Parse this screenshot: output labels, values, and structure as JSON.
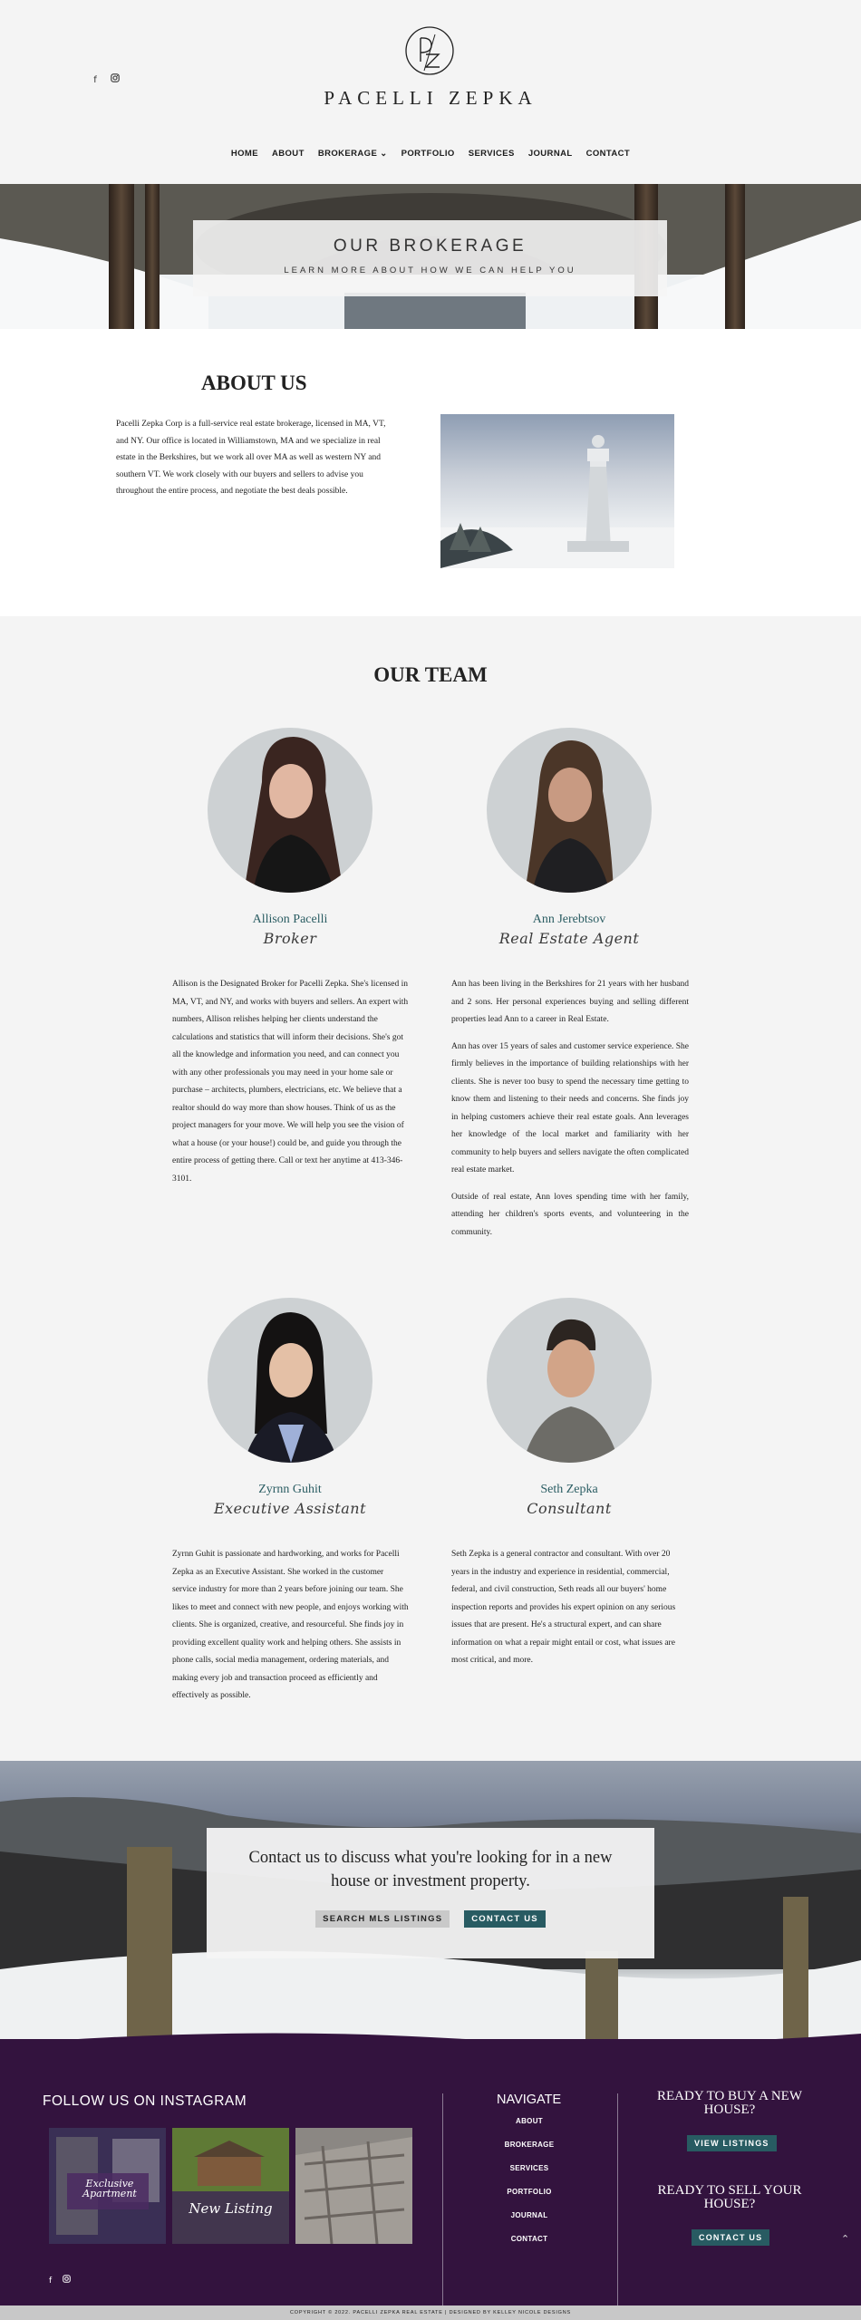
{
  "header": {
    "brand": "PACELLI ZEPKA",
    "social_icons": [
      "facebook-icon",
      "instagram-icon"
    ],
    "nav": [
      {
        "label": "HOME"
      },
      {
        "label": "ABOUT"
      },
      {
        "label": "BROKERAGE ⌄"
      },
      {
        "label": "PORTFOLIO"
      },
      {
        "label": "SERVICES"
      },
      {
        "label": "JOURNAL"
      },
      {
        "label": "CONTACT"
      }
    ]
  },
  "hero": {
    "title": "OUR BROKERAGE",
    "subtitle": "LEARN MORE ABOUT HOW WE CAN HELP YOU"
  },
  "about": {
    "title": "ABOUT US",
    "text": "Pacelli Zepka Corp is a full-service real estate brokerage, licensed in MA, VT, and NY. Our office is located in Williamstown, MA and we specialize in real estate in the Berkshires, but we work all over MA as well as western NY and southern VT. We work closely with our buyers and sellers to advise you throughout the entire process, and negotiate the best deals possible."
  },
  "team": {
    "title": "OUR TEAM",
    "members": [
      {
        "name": "Allison Pacelli",
        "role": "Broker",
        "bio": [
          "Allison is the Designated Broker for Pacelli Zepka. She's licensed in MA, VT, and NY, and works with buyers and sellers. An expert with numbers, Allison relishes helping her clients understand the calculations and statistics that will inform their decisions. She's got all the knowledge and information you need, and can connect you with any other professionals you may need in your home sale or purchase – architects, plumbers, electricians, etc. We believe that a realtor should do way more than show houses. Think of us as the project managers for your move. We will help you see the vision of what a house (or your house!) could be, and guide you through the entire process of getting there. Call or text her anytime at 413-346-3101."
        ]
      },
      {
        "name": "Ann Jerebtsov",
        "role": "Real Estate Agent",
        "bio": [
          "Ann has been living in the Berkshires for 21 years with her husband and 2 sons. Her personal experiences buying and selling different properties lead Ann to a career in Real Estate.",
          "Ann has over 15 years of sales and customer service experience. She firmly believes in the importance of building relationships with her clients. She is never too busy to spend the necessary time getting to know them and listening to their needs and concerns. She finds joy in helping customers achieve their real estate goals. Ann leverages her knowledge of the local market and familiarity with her community to help buyers and sellers navigate the often complicated real estate market.",
          "Outside of real estate, Ann loves spending time with her family, attending her children's sports events, and volunteering in the community."
        ]
      },
      {
        "name": "Zyrnn Guhit",
        "role": "Executive Assistant",
        "bio": [
          "Zyrnn Guhit is passionate and hardworking, and works for Pacelli Zepka as an Executive Assistant. She worked in the customer service industry for more than 2 years before joining our team. She likes to meet and connect with new people, and enjoys working with clients. She is organized, creative, and resourceful.  She finds joy in providing excellent quality work and helping others. She assists in phone calls, social media management, ordering materials, and making every job and transaction proceed as efficiently and effectively as possible."
        ]
      },
      {
        "name": "Seth Zepka",
        "role": "Consultant",
        "bio": [
          "Seth Zepka is a general contractor and consultant. With over 20 years in the industry and experience in residential, commercial, federal, and civil construction, Seth reads all our buyers' home inspection reports and provides his expert opinion on any serious issues that are present. He's a structural expert, and can share information on what a repair might entail or cost, what issues are most critical, and more."
        ]
      }
    ]
  },
  "contact": {
    "text": "Contact us to discuss what you're looking for in a new house or investment property.",
    "btn_mls": "SEARCH MLS LISTINGS",
    "btn_contact": "CONTACT US"
  },
  "footer": {
    "instagram_title": "FOLLOW US ON INSTAGRAM",
    "thumb_texts": [
      "Exclusive Apartment",
      "New Listing"
    ],
    "navigate_title": "NAVIGATE",
    "nav": [
      "ABOUT",
      "BROKERAGE",
      "SERVICES",
      "PORTFOLIO",
      "JOURNAL",
      "CONTACT"
    ],
    "buy_title": "READY TO BUY A NEW HOUSE?",
    "buy_btn": "VIEW LISTINGS",
    "sell_title": "READY TO SELL YOUR HOUSE?",
    "sell_btn": "CONTACT US",
    "social_icons": [
      "facebook-icon",
      "instagram-icon"
    ],
    "copyright": "COPYRIGHT © 2022. PACELLI ZEPKA REAL ESTATE | DESIGNED BY KELLEY NICOLE DESIGNS"
  },
  "colors": {
    "accent_teal": "#285b62",
    "footer_purple": "#33133e",
    "background": "#f4f4f4"
  }
}
